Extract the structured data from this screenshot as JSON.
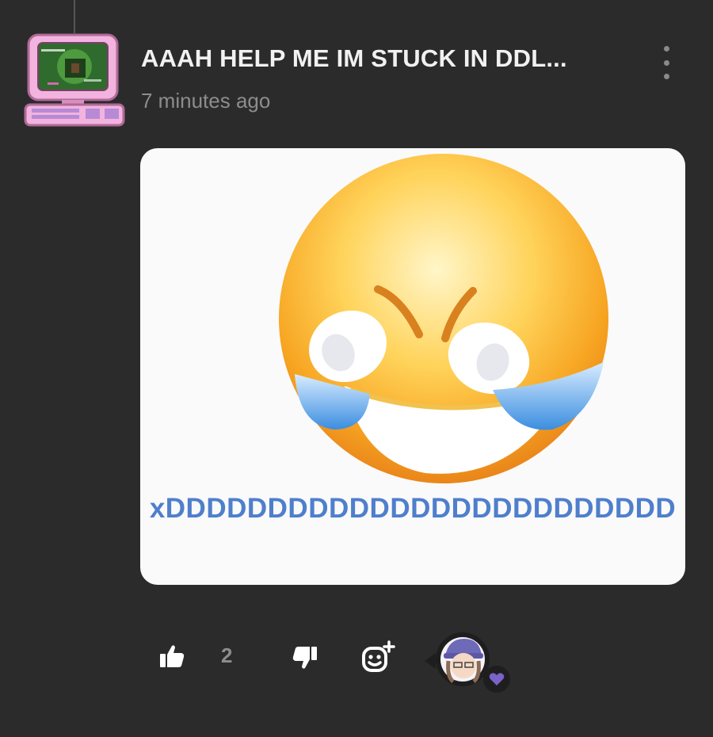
{
  "post": {
    "title": "AAAH HELP ME IM STUCK IN DDL...",
    "timestamp": "7 minutes ago"
  },
  "media": {
    "caption": "xDDDDDDDDDDDDDDDDDDDDDDDDD"
  },
  "actions": {
    "like_count": "2"
  },
  "colors": {
    "background": "#2b2b2b",
    "caption_blue": "#4f7fcc",
    "heart_purple": "#7a62c9",
    "avatar_pink": "#f0a8d8"
  },
  "icons": [
    "thumbs-up-icon",
    "thumbs-down-icon",
    "add-reaction-icon",
    "heart-icon",
    "more-vertical-icon"
  ]
}
